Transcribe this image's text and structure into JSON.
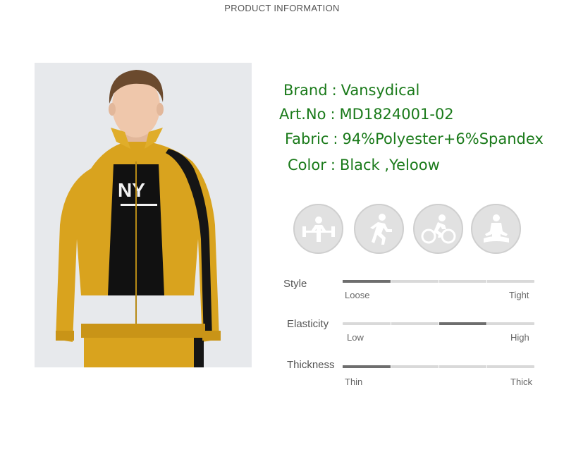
{
  "header": {
    "title": "PRODUCT INFORMATION"
  },
  "photo": {
    "shirt_text": "NY"
  },
  "info": {
    "rows": [
      {
        "label": "Brand",
        "value": "Vansydical"
      },
      {
        "label": "Art.No",
        "value": "MD1824001-02"
      },
      {
        "label": "Fabric",
        "value": "94%Polyester+6%Spandex"
      },
      {
        "label": "Color",
        "value": "Black ,Yeloow"
      }
    ],
    "separator": ":",
    "text_color": "#1a7a1a"
  },
  "icons": [
    {
      "name": "weightlifting-icon"
    },
    {
      "name": "running-icon"
    },
    {
      "name": "cycling-icon"
    },
    {
      "name": "meditation-icon"
    }
  ],
  "properties": [
    {
      "label": "Style",
      "low_label": "Loose",
      "high_label": "Tight",
      "level_segment": 1,
      "segments": 4
    },
    {
      "label": "Elasticity",
      "low_label": "Low",
      "high_label": "High",
      "level_segment": 3,
      "segments": 4
    },
    {
      "label": "Thickness",
      "low_label": "Thin",
      "high_label": "Thick",
      "level_segment": 1,
      "segments": 4
    }
  ],
  "colors": {
    "jacket_yellow": "#d9a31e",
    "stripe_black": "#151515",
    "icon_bg": "#e1e1e1",
    "bar_fill": "#6e6e6e"
  }
}
